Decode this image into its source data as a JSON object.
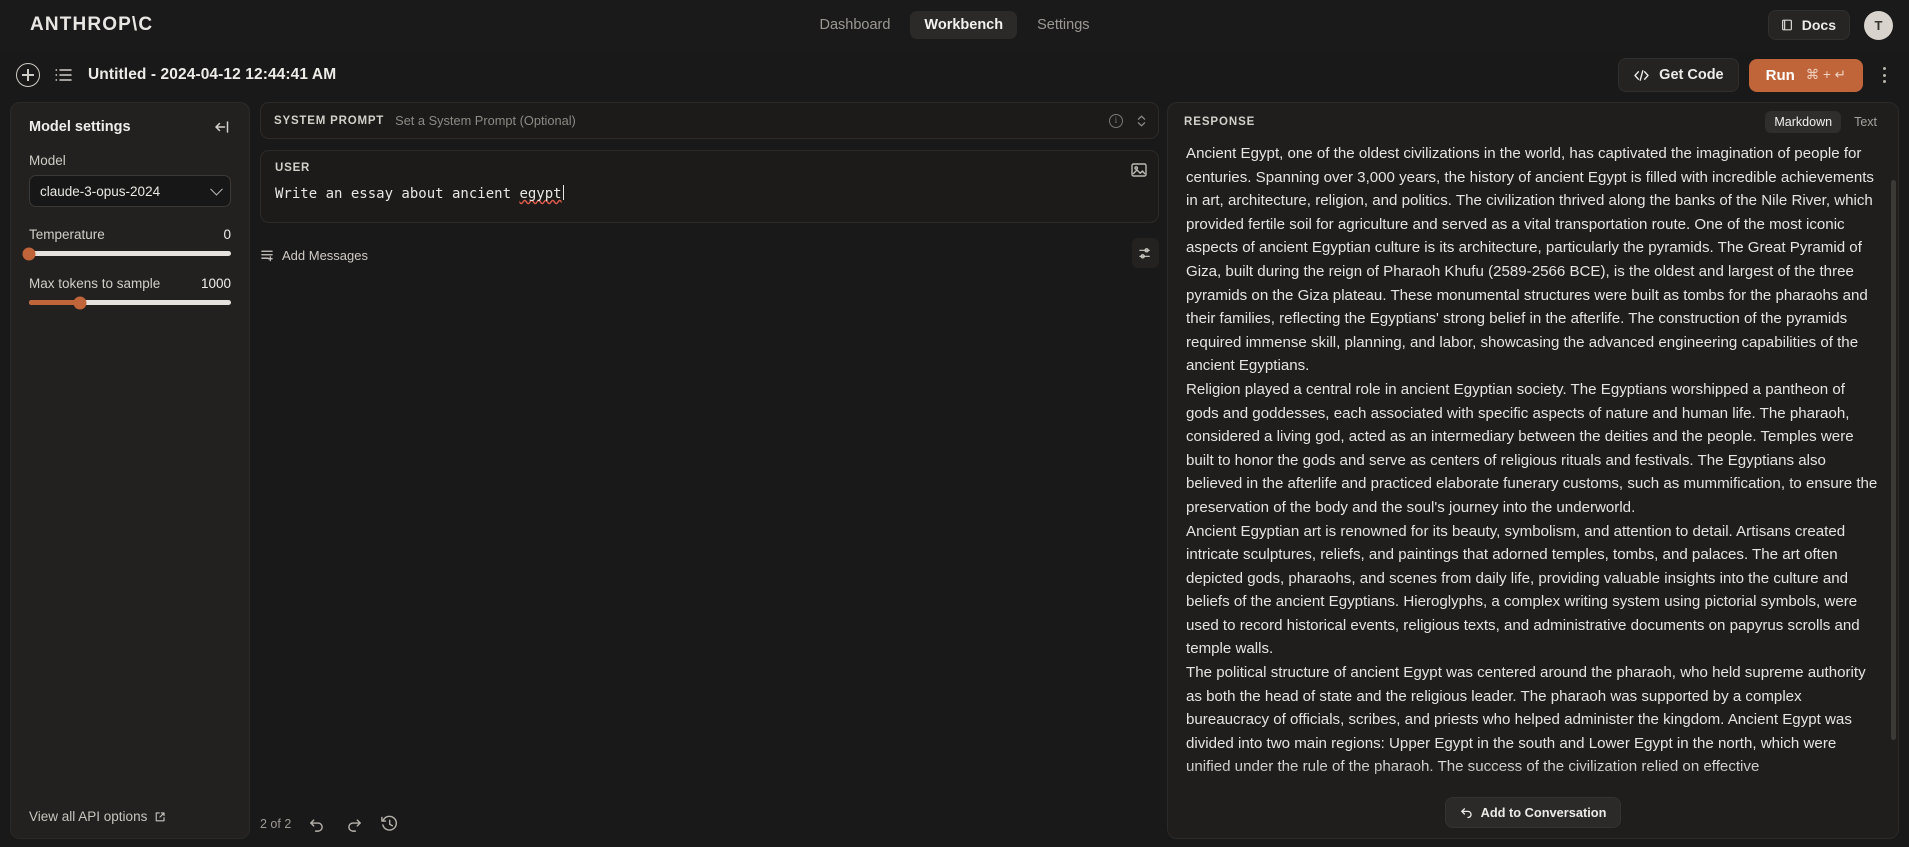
{
  "topnav": {
    "brand": "ANTHROP\\C",
    "links": [
      {
        "label": "Dashboard",
        "active": false
      },
      {
        "label": "Workbench",
        "active": true
      },
      {
        "label": "Settings",
        "active": false
      }
    ],
    "docs_label": "Docs",
    "docs_icon": "book-icon",
    "avatar_initial": "T"
  },
  "toolbar": {
    "new_icon": "circle-plus-icon",
    "list_icon": "list-icon",
    "title": "Untitled - 2024-04-12 12:44:41 AM",
    "get_code_label": "Get Code",
    "get_code_icon": "code-brackets-icon",
    "run_label": "Run",
    "run_shortcut": "⌘ + ↵",
    "run_color": "#c0653a",
    "more_icon": "kebab-menu-icon"
  },
  "sidebar": {
    "title": "Model settings",
    "collapse_icon": "collapse-panel-icon",
    "model_label": "Model",
    "model_value": "claude-3-opus-2024",
    "temperature": {
      "label": "Temperature",
      "value": "0",
      "percent": 0
    },
    "max_tokens": {
      "label": "Max tokens to sample",
      "value": "1000",
      "percent": 25
    },
    "footer_link": "View all API options",
    "footer_icon": "external-link-icon"
  },
  "prompt": {
    "system_label": "SYSTEM PROMPT",
    "system_placeholder": "Set a System Prompt (Optional)",
    "info_icon": "info-icon",
    "expand_icon": "expand-collapse-icon",
    "user_label": "USER",
    "user_text_ok": "Write an essay about ancient ",
    "user_text_misspelled": "egypt",
    "image_icon": "image-attach-icon",
    "add_messages_label": "Add Messages",
    "add_messages_icon": "add-messages-icon",
    "settings_icon": "sliders-icon",
    "page_count": "2 of 2",
    "undo_icon": "undo-icon",
    "redo_icon": "redo-icon",
    "history_icon": "history-icon"
  },
  "response": {
    "label": "RESPONSE",
    "views": [
      {
        "label": "Markdown",
        "active": true
      },
      {
        "label": "Text",
        "active": false
      }
    ],
    "paragraphs": [
      "Ancient Egypt, one of the oldest civilizations in the world, has captivated the imagination of people for centuries. Spanning over 3,000 years, the history of ancient Egypt is filled with incredible achievements in art, architecture, religion, and politics. The civilization thrived along the banks of the Nile River, which provided fertile soil for agriculture and served as a vital transportation route. One of the most iconic aspects of ancient Egyptian culture is its architecture, particularly the pyramids. The Great Pyramid of Giza, built during the reign of Pharaoh Khufu (2589-2566 BCE), is the oldest and largest of the three pyramids on the Giza plateau. These monumental structures were built as tombs for the pharaohs and their families, reflecting the Egyptians' strong belief in the afterlife. The construction of the pyramids required immense skill, planning, and labor, showcasing the advanced engineering capabilities of the ancient Egyptians.",
      "Religion played a central role in ancient Egyptian society. The Egyptians worshipped a pantheon of gods and goddesses, each associated with specific aspects of nature and human life. The pharaoh, considered a living god, acted as an intermediary between the deities and the people. Temples were built to honor the gods and serve as centers of religious rituals and festivals. The Egyptians also believed in the afterlife and practiced elaborate funerary customs, such as mummification, to ensure the preservation of the body and the soul's journey into the underworld.",
      "Ancient Egyptian art is renowned for its beauty, symbolism, and attention to detail. Artisans created intricate sculptures, reliefs, and paintings that adorned temples, tombs, and palaces. The art often depicted gods, pharaohs, and scenes from daily life, providing valuable insights into the culture and beliefs of the ancient Egyptians. Hieroglyphs, a complex writing system using pictorial symbols, were used to record historical events, religious texts, and administrative documents on papyrus scrolls and temple walls.",
      "The political structure of ancient Egypt was centered around the pharaoh, who held supreme authority as both the head of state and the religious leader. The pharaoh was supported by a complex bureaucracy of officials, scribes, and priests who helped administer the kingdom. Ancient Egypt was divided into two main regions: Upper Egypt in the south and Lower Egypt in the north, which were unified under the rule of the pharaoh. The success of the civilization relied on effective"
    ],
    "add_to_conversation_label": "Add to Conversation",
    "add_to_conversation_icon": "reply-arrow-icon"
  }
}
